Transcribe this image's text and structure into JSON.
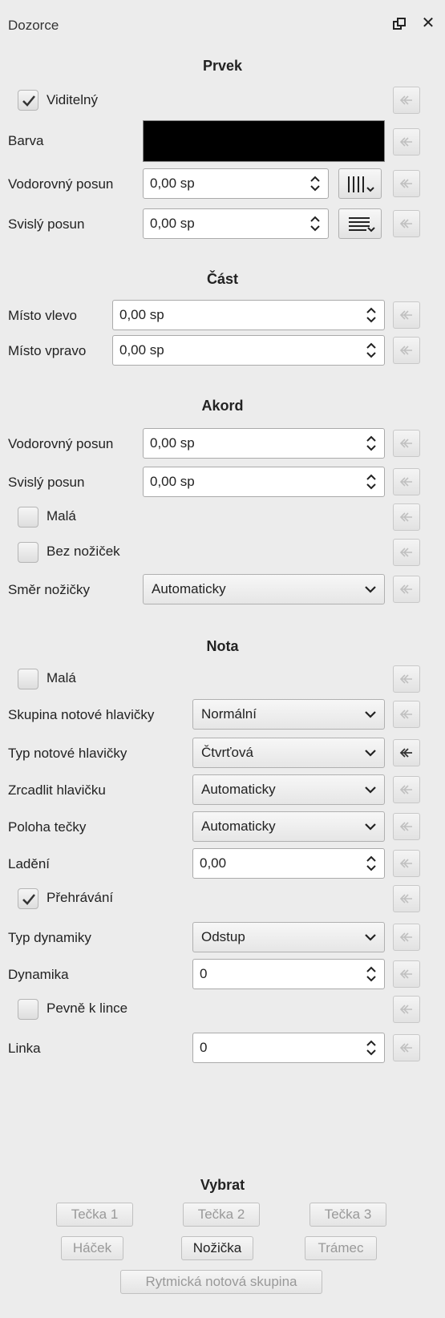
{
  "window": {
    "title": "Dozorce"
  },
  "sections": {
    "prvek": {
      "title": "Prvek",
      "visible_label": "Viditelný",
      "visible_checked": true,
      "color_label": "Barva",
      "color_value": "#000000",
      "hoffset_label": "Vodorovný posun",
      "hoffset_value": "0,00 sp",
      "voffset_label": "Svislý posun",
      "voffset_value": "0,00 sp"
    },
    "cast": {
      "title": "Část",
      "left_label": "Místo vlevo",
      "left_value": "0,00 sp",
      "right_label": "Místo vpravo",
      "right_value": "0,00 sp"
    },
    "akord": {
      "title": "Akord",
      "hoffset_label": "Vodorovný posun",
      "hoffset_value": "0,00 sp",
      "voffset_label": "Svislý posun",
      "voffset_value": "0,00 sp",
      "small_label": "Malá",
      "small_checked": false,
      "nostem_label": "Bez nožiček",
      "nostem_checked": false,
      "stemdir_label": "Směr nožičky",
      "stemdir_value": "Automaticky"
    },
    "nota": {
      "title": "Nota",
      "small_label": "Malá",
      "small_checked": false,
      "headgroup_label": "Skupina notové hlavičky",
      "headgroup_value": "Normální",
      "headtype_label": "Typ notové hlavičky",
      "headtype_value": "Čtvrťová",
      "mirror_label": "Zrcadlit hlavičku",
      "mirror_value": "Automaticky",
      "dotpos_label": "Poloha tečky",
      "dotpos_value": "Automaticky",
      "tuning_label": "Ladění",
      "tuning_value": "0,00",
      "play_label": "Přehrávání",
      "play_checked": true,
      "dyntype_label": "Typ dynamiky",
      "dyntype_value": "Odstup",
      "dynamics_label": "Dynamika",
      "dynamics_value": "0",
      "fixline_label": "Pevně k lince",
      "fixline_checked": false,
      "line_label": "Linka",
      "line_value": "0"
    },
    "vybrat": {
      "title": "Vybrat",
      "dot1": "Tečka 1",
      "dot2": "Tečka 2",
      "dot3": "Tečka 3",
      "hook": "Háček",
      "stem": "Nožička",
      "beam": "Trámec",
      "tuplet": "Rytmická notová skupina"
    }
  },
  "icons": {
    "reset": "reset-arrow-icon",
    "float": "float-icon",
    "close": "close-icon",
    "check": "checkmark-icon",
    "hspacing": "horizontal-align-icon",
    "vspacing": "vertical-align-icon"
  }
}
